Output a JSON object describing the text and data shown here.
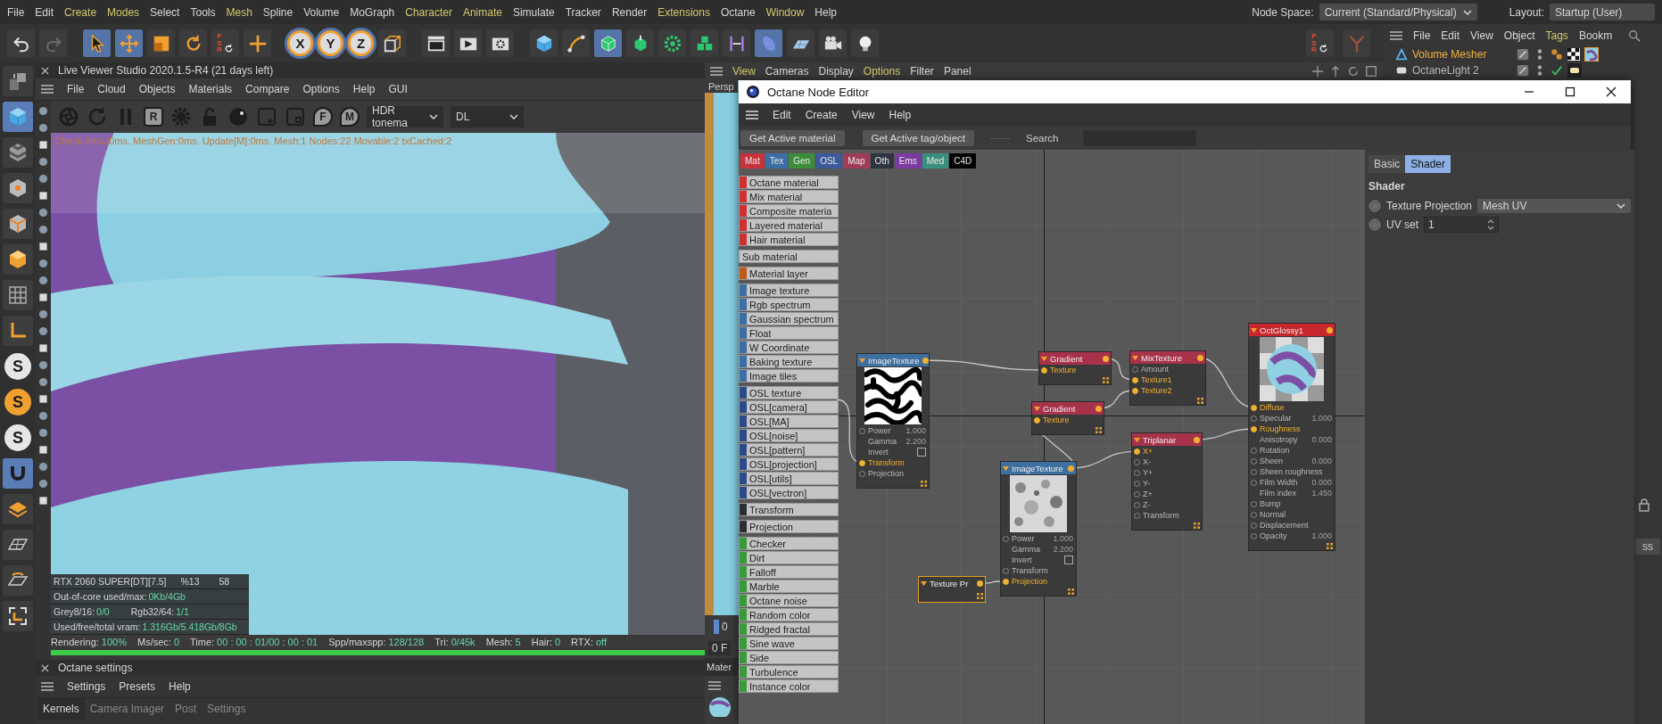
{
  "menubar": {
    "items": [
      {
        "label": "File",
        "highlighted": false
      },
      {
        "label": "Edit",
        "highlighted": false
      },
      {
        "label": "Create",
        "highlighted": true
      },
      {
        "label": "Modes",
        "highlighted": true
      },
      {
        "label": "Select",
        "highlighted": false
      },
      {
        "label": "Tools",
        "highlighted": false
      },
      {
        "label": "Mesh",
        "highlighted": true
      },
      {
        "label": "Spline",
        "highlighted": false
      },
      {
        "label": "Volume",
        "highlighted": false
      },
      {
        "label": "MoGraph",
        "highlighted": false
      },
      {
        "label": "Character",
        "highlighted": true
      },
      {
        "label": "Animate",
        "highlighted": true
      },
      {
        "label": "Simulate",
        "highlighted": false
      },
      {
        "label": "Tracker",
        "highlighted": false
      },
      {
        "label": "Render",
        "highlighted": false
      },
      {
        "label": "Extensions",
        "highlighted": true
      },
      {
        "label": "Octane",
        "highlighted": false
      },
      {
        "label": "Window",
        "highlighted": true
      },
      {
        "label": "Help",
        "highlighted": false
      }
    ],
    "node_space": {
      "label": "Node Space:",
      "value": "Current (Standard/Physical)"
    },
    "layout": {
      "label": "Layout:",
      "value": "Startup (User)"
    }
  },
  "toolbar": {
    "tools": [
      {
        "kind": "undo",
        "selected": false
      },
      {
        "kind": "redo",
        "selected": false
      },
      {
        "kind": "select",
        "selected": true
      },
      {
        "kind": "move",
        "selected": true
      },
      {
        "kind": "scale",
        "selected": false
      },
      {
        "kind": "rotate",
        "selected": false
      },
      {
        "kind": "psr",
        "label": "PSR",
        "selected": false
      },
      {
        "kind": "crosshair",
        "selected": false
      },
      {
        "kind": "axis",
        "label": "X",
        "selected": true
      },
      {
        "kind": "axis",
        "label": "Y",
        "selected": true
      },
      {
        "kind": "axis",
        "label": "Z",
        "selected": true
      },
      {
        "kind": "coords",
        "selected": false
      },
      {
        "kind": "clapper",
        "selected": false
      },
      {
        "kind": "render",
        "selected": false
      },
      {
        "kind": "render-settings",
        "selected": false
      },
      {
        "kind": "cube",
        "selected": false
      },
      {
        "kind": "pen",
        "selected": false
      },
      {
        "kind": "subdivision",
        "selected": true
      },
      {
        "kind": "extrude",
        "selected": false
      },
      {
        "kind": "cloner",
        "selected": false
      },
      {
        "kind": "cubes",
        "selected": false
      },
      {
        "kind": "symmetry",
        "selected": false
      },
      {
        "kind": "deformer",
        "selected": true
      },
      {
        "kind": "floor",
        "selected": false
      },
      {
        "kind": "camera",
        "selected": false
      },
      {
        "kind": "light",
        "selected": false
      }
    ],
    "right_tools": [
      {
        "kind": "psr",
        "label": "PSR",
        "selected": false
      },
      {
        "kind": "tripod",
        "selected": false
      }
    ]
  },
  "left_tools": [
    {
      "kind": "model",
      "selected": false
    },
    {
      "kind": "cube",
      "selected": true
    },
    {
      "kind": "checker-cube",
      "selected": false
    },
    {
      "kind": "point-cube",
      "selected": false
    },
    {
      "kind": "edge-cube",
      "selected": false
    },
    {
      "kind": "polygon-cube",
      "selected": false
    },
    {
      "kind": "texture-grid",
      "selected": false
    },
    {
      "kind": "world-axis",
      "selected": false
    },
    {
      "kind": "snap",
      "label": "S",
      "selected": false
    },
    {
      "kind": "snap",
      "label": "S",
      "selected": true
    },
    {
      "kind": "snap",
      "label": "S",
      "selected": false
    },
    {
      "kind": "magnet",
      "selected": true
    },
    {
      "kind": "layers",
      "selected": false
    },
    {
      "kind": "plane",
      "selected": false
    },
    {
      "kind": "plane-rotate",
      "selected": false
    },
    {
      "kind": "corner-axis",
      "selected": false
    }
  ],
  "live_viewer": {
    "title": "Live Viewer Studio 2020.1.5-R4 (21 days left)",
    "menu": [
      "File",
      "Cloud",
      "Objects",
      "Materials",
      "Compare",
      "Options",
      "Help",
      "GUI"
    ],
    "tools": [
      {
        "kind": "aperture"
      },
      {
        "kind": "refresh"
      },
      {
        "kind": "pause"
      },
      {
        "kind": "letter",
        "label": "R"
      },
      {
        "kind": "gear"
      },
      {
        "kind": "lock"
      },
      {
        "kind": "ball"
      },
      {
        "kind": "add"
      },
      {
        "kind": "frame"
      },
      {
        "kind": "pin",
        "label": "F"
      },
      {
        "kind": "pin",
        "label": "M"
      }
    ],
    "tonemap": "HDR tonema",
    "mode": "DL",
    "overlay": "Check:0ms./0ms. MeshGen:0ms. Update[M]:0ms. Mesh:1 Nodes:22 Movable:2 txCached:2",
    "gpu": {
      "name": "RTX 2060 SUPER[DT][7.5]",
      "usage": "%13",
      "temperature": "58"
    },
    "stats": [
      [
        {
          "label": "Out-of-core used/max:",
          "value": "0Kb/4Gb"
        }
      ],
      [
        {
          "label": "Grey8/16:",
          "value": "0/0"
        },
        {
          "label": "Rgb32/64:",
          "value": "1/1"
        }
      ],
      [
        {
          "label": "Used/free/total vram:",
          "value": "1.316Gb/5.418Gb/8Gb"
        }
      ]
    ],
    "status": [
      {
        "label": "Rendering:",
        "value": "100%"
      },
      {
        "label": "Ms/sec:",
        "value": "0"
      },
      {
        "label": "Time:",
        "value": "00 : 00 : 01/00 : 00 : 01"
      },
      {
        "label": "Spp/maxspp:",
        "value": "128/128"
      },
      {
        "label": "Tri:",
        "value": "0/45k"
      },
      {
        "label": "Mesh:",
        "value": "5"
      },
      {
        "label": "Hair:",
        "value": "0"
      },
      {
        "label": "RTX:",
        "value": "off"
      }
    ],
    "progress": {
      "level": 1
    }
  },
  "octane_settings": {
    "title": "Octane settings",
    "menu": [
      "Settings",
      "Presets",
      "Help"
    ],
    "tabs": [
      {
        "label": "Kernels",
        "selected": true
      },
      {
        "label": "Camera Imager",
        "selected": false
      },
      {
        "label": "Post",
        "selected": false
      },
      {
        "label": "Settings",
        "selected": false
      }
    ]
  },
  "viewport": {
    "menu": [
      {
        "label": "View",
        "highlighted": true
      },
      {
        "label": "Cameras",
        "highlighted": false
      },
      {
        "label": "Display",
        "highlighted": false
      },
      {
        "label": "Options",
        "highlighted": true
      },
      {
        "label": "Filter",
        "highlighted": false
      },
      {
        "label": "Panel",
        "highlighted": false
      }
    ],
    "camera": "Persp",
    "frame": "0",
    "frame_field": "0 F",
    "material_manager": "Mater"
  },
  "object_manager": {
    "menu": [
      {
        "label": "File",
        "highlighted": false
      },
      {
        "label": "Edit",
        "highlighted": false
      },
      {
        "label": "View",
        "highlighted": false
      },
      {
        "label": "Object",
        "highlighted": false
      },
      {
        "label": "Tags",
        "highlighted": true
      },
      {
        "label": "Bookm",
        "highlighted": false
      }
    ],
    "objects": [
      {
        "name": "Volume Mesher",
        "selected": true
      },
      {
        "name": "OctaneLight 2",
        "selected": false
      }
    ],
    "side_button": "ss"
  },
  "node_editor": {
    "title": "Octane Node Editor",
    "menu": [
      "Edit",
      "Create",
      "View",
      "Help"
    ],
    "buttons": [
      "Get Active material",
      "Get Active tag/object"
    ],
    "search_label": "Search",
    "categories": [
      {
        "label": "Mat",
        "color": "#c8323c"
      },
      {
        "label": "Tex",
        "color": "#3a6ea5"
      },
      {
        "label": "Gen",
        "color": "#3a8e3a"
      },
      {
        "label": "OSL",
        "color": "#3c5a9a"
      },
      {
        "label": "Map",
        "color": "#a03c5a"
      },
      {
        "label": "Oth",
        "color": "#2e3440"
      },
      {
        "label": "Ems",
        "color": "#7a3aa0"
      },
      {
        "label": "Med",
        "color": "#3a9080"
      },
      {
        "label": "C4D",
        "color": "#000000"
      }
    ],
    "node_groups": [
      {
        "items": [
          {
            "label": "Octane material",
            "color": "#d03030"
          },
          {
            "label": "Mix material",
            "color": "#d03030"
          },
          {
            "label": "Composite materia",
            "color": "#d03030"
          },
          {
            "label": "Layered material",
            "color": "#d03030"
          },
          {
            "label": "Hair material",
            "color": "#d03030"
          }
        ]
      },
      {
        "items": [
          {
            "label": "Sub material"
          }
        ]
      },
      {
        "items": [
          {
            "label": "Material layer",
            "color": "#c05a1a"
          }
        ]
      },
      {
        "items": [
          {
            "label": "Image texture",
            "color": "#3a6ea5"
          },
          {
            "label": "Rgb spectrum",
            "color": "#3a6ea5"
          },
          {
            "label": "Gaussian spectrum",
            "color": "#3a6ea5"
          },
          {
            "label": "Float",
            "color": "#3a6ea5"
          },
          {
            "label": "W Coordinate",
            "color": "#3a6ea5"
          },
          {
            "label": "Baking texture",
            "color": "#3a6ea5"
          },
          {
            "label": "Image tiles",
            "color": "#3a6ea5"
          }
        ]
      },
      {
        "items": [
          {
            "label": "OSL texture",
            "color": "#2a4a8a"
          },
          {
            "label": "OSL[camera]",
            "color": "#2a4a8a"
          },
          {
            "label": "OSL[MA]",
            "color": "#2a4a8a"
          },
          {
            "label": "OSL[noise]",
            "color": "#2a4a8a"
          },
          {
            "label": "OSL[pattern]",
            "color": "#2a4a8a"
          },
          {
            "label": "OSL[projection]",
            "color": "#2a4a8a"
          },
          {
            "label": "OSL[utils]",
            "color": "#2a4a8a"
          },
          {
            "label": "OSL[vectron]",
            "color": "#2a4a8a"
          }
        ]
      },
      {
        "items": [
          {
            "label": "Transform",
            "color": "#2a2e36"
          }
        ]
      },
      {
        "items": [
          {
            "label": "Projection",
            "color": "#2a2e36"
          }
        ]
      },
      {
        "items": [
          {
            "label": "Checker",
            "color": "#3a9a3a"
          },
          {
            "label": "Dirt",
            "color": "#3a9a3a"
          },
          {
            "label": "Falloff",
            "color": "#3a9a3a"
          },
          {
            "label": "Marble",
            "color": "#3a9a3a"
          },
          {
            "label": "Octane noise",
            "color": "#3a9a3a"
          },
          {
            "label": "Random color",
            "color": "#3a9a3a"
          },
          {
            "label": "Ridged fractal",
            "color": "#3a9a3a"
          },
          {
            "label": "Sine wave",
            "color": "#3a9a3a"
          },
          {
            "label": "Side",
            "color": "#3a9a3a"
          },
          {
            "label": "Turbulence",
            "color": "#3a9a3a"
          },
          {
            "label": "Instance color",
            "color": "#3a9a3a"
          }
        ]
      }
    ],
    "nodes": [
      {
        "title": "ImageTexture",
        "color": "#3d6fa0",
        "selected": false,
        "kind": "pattern",
        "ports": [
          {
            "label": "Power",
            "value": "1.000",
            "kind": "socket",
            "connected": false
          },
          {
            "label": "Gamma",
            "value": "2.200",
            "kind": "plain",
            "connected": false
          },
          {
            "label": "Invert",
            "kind": "toggle",
            "checked": false,
            "connected": false
          },
          {
            "label": "Transform",
            "kind": "socket",
            "connected": true
          },
          {
            "label": "Projection",
            "kind": "socket",
            "connected": false
          }
        ]
      },
      {
        "title": "Gradient",
        "color": "#a8324a",
        "selected": false,
        "kind": "plain",
        "ports": [
          {
            "label": "Texture",
            "kind": "socket",
            "connected": true
          }
        ]
      },
      {
        "title": "Gradient",
        "color": "#a8324a",
        "selected": false,
        "kind": "plain",
        "ports": [
          {
            "label": "Texture",
            "kind": "socket",
            "connected": true
          }
        ]
      },
      {
        "title": "Texture Pr",
        "color": "#3a3a3a",
        "selected": true,
        "kind": "plain"
      },
      {
        "title": "ImageTexture",
        "color": "#3d6fa0",
        "selected": false,
        "kind": "noise",
        "ports": [
          {
            "label": "Power",
            "value": "1.000",
            "kind": "socket",
            "connected": false
          },
          {
            "label": "Gamma",
            "value": "2.200",
            "kind": "plain",
            "connected": false
          },
          {
            "label": "Invert",
            "kind": "toggle",
            "checked": false,
            "connected": false
          },
          {
            "label": "Transform",
            "kind": "socket",
            "connected": false
          },
          {
            "label": "Projection",
            "kind": "socket",
            "connected": true
          }
        ]
      },
      {
        "title": "MixTexture",
        "color": "#a8324a",
        "selected": false,
        "kind": "plain",
        "ports": [
          {
            "label": "Amount",
            "kind": "socket",
            "connected": false
          },
          {
            "label": "Texture1",
            "kind": "socket",
            "connected": true
          },
          {
            "label": "Texture2",
            "kind": "socket",
            "connected": true
          }
        ]
      },
      {
        "title": "Triplanar",
        "color": "#a8324a",
        "selected": false,
        "kind": "plain",
        "ports": [
          {
            "label": "X+",
            "kind": "socket",
            "connected": true
          },
          {
            "label": "X-",
            "kind": "socket",
            "connected": false
          },
          {
            "label": "Y+",
            "kind": "socket",
            "connected": false
          },
          {
            "label": "Y-",
            "kind": "socket",
            "connected": false
          },
          {
            "label": "Z+",
            "kind": "socket",
            "connected": false
          },
          {
            "label": "Z-",
            "kind": "socket",
            "connected": false
          },
          {
            "label": "Transform",
            "kind": "socket",
            "connected": false
          }
        ]
      },
      {
        "title": "OctGlossy1",
        "color": "#c8282d",
        "selected": false,
        "kind": "sphere",
        "ports": [
          {
            "label": "Diffuse",
            "kind": "socket",
            "connected": true
          },
          {
            "label": "Specular",
            "value": "1.000",
            "kind": "socket",
            "connected": false
          },
          {
            "label": "Roughness",
            "kind": "socket",
            "connected": true
          },
          {
            "label": "Anisotropy",
            "value": "0.000",
            "kind": "plain",
            "connected": false
          },
          {
            "label": "Rotation",
            "kind": "socket",
            "connected": false
          },
          {
            "label": "Sheen",
            "value": "0.000",
            "kind": "socket",
            "connected": false
          },
          {
            "label": "Sheen roughness",
            "kind": "socket",
            "connected": false
          },
          {
            "label": "Film Width",
            "value": "0.000",
            "kind": "socket",
            "connected": false
          },
          {
            "label": "Film index",
            "value": "1.450",
            "kind": "plain",
            "connected": false
          },
          {
            "label": "Bump",
            "kind": "socket",
            "connected": false
          },
          {
            "label": "Normal",
            "kind": "socket",
            "connected": false
          },
          {
            "label": "Displacement",
            "kind": "socket",
            "connected": false
          },
          {
            "label": "Opacity",
            "value": "1.000",
            "kind": "socket",
            "connected": false
          }
        ]
      }
    ],
    "properties": {
      "tabs": [
        {
          "label": "Basic",
          "selected": false
        },
        {
          "label": "Shader",
          "selected": true
        }
      ],
      "heading": "Shader",
      "fields": [
        {
          "kind": "dropdown",
          "label": "Texture Projection",
          "value": "Mesh UV"
        },
        {
          "kind": "spinner",
          "label": "UV set",
          "value": "1"
        }
      ]
    }
  }
}
